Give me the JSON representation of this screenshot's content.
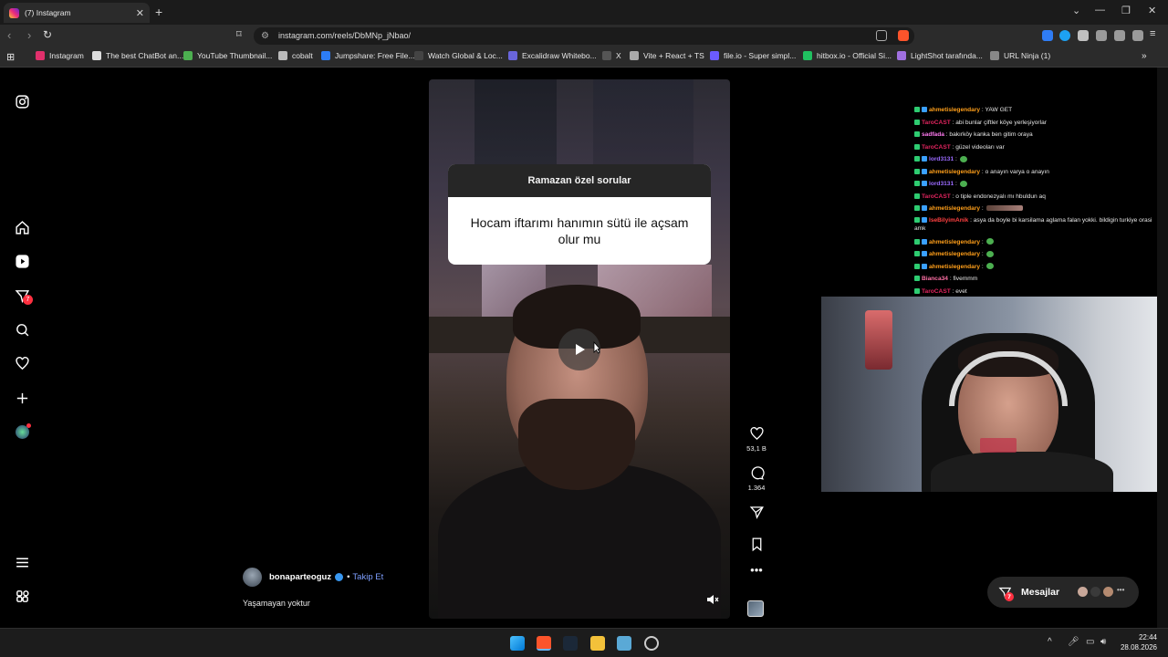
{
  "browser": {
    "tab_title": "(7) Instagram",
    "url": "instagram.com/reels/DbMNp_jNbao/",
    "bookmarks": [
      {
        "label": "Instagram",
        "color": "#e1306c"
      },
      {
        "label": "The best ChatBot an...",
        "color": "#dddddd"
      },
      {
        "label": "YouTube Thumbnail...",
        "color": "#4caf50"
      },
      {
        "label": "cobalt",
        "color": "#bbbbbb"
      },
      {
        "label": "Jumpshare: Free File...",
        "color": "#2d7df6"
      },
      {
        "label": "Watch Global & Loc...",
        "color": "#111111"
      },
      {
        "label": "Excalidraw Whitebo...",
        "color": "#6965db"
      },
      {
        "label": "X",
        "color": "#000000"
      },
      {
        "label": "Vite + React + TS",
        "color": "#aaaaaa"
      },
      {
        "label": "file.io - Super simpl...",
        "color": "#6b5bff"
      },
      {
        "label": "hitbox.io - Official Si...",
        "color": "#20c060"
      },
      {
        "label": "LightShot tarafında...",
        "color": "#a070e0"
      },
      {
        "label": "URL Ninja (1)",
        "color": "#888888"
      }
    ]
  },
  "sidebar": {
    "messages_badge": "7"
  },
  "reel": {
    "question_header": "Ramazan özel sorular",
    "question_text": "Hocam iftarımı hanımın sütü ile açsam olur mu",
    "likes": "53,1 B",
    "comments": "1.364",
    "author": "bonaparteoguz",
    "follow_label": "Takip Et",
    "caption": "Yaşamayan yoktur"
  },
  "chat": [
    {
      "user": "ahmetislegendary",
      "text": ": YAW GET",
      "color": "#ff9f1a"
    },
    {
      "user": "TaroCAST",
      "text": ": abi bunlar çiftler köye yerleşiyorlar",
      "color": "#e0245e"
    },
    {
      "user": "sadfada",
      "text": ": bakırköy kanka ben gitim oraya",
      "color": "#ff7af0"
    },
    {
      "user": "TaroCAST",
      "text": ": güzel videoları var",
      "color": "#e0245e"
    },
    {
      "user": "lord3131",
      "text": ":",
      "color": "#9b6bff",
      "emote": true
    },
    {
      "user": "ahmetislegendary",
      "text": ": o anayın varya o anayın",
      "color": "#ff9f1a"
    },
    {
      "user": "lord3131",
      "text": ":",
      "color": "#9b6bff",
      "emote": true
    },
    {
      "user": "TaroCAST",
      "text": ": o tiple endonezyalı mı hbuldun aq",
      "color": "#e0245e"
    },
    {
      "user": "ahmetislegendary",
      "text": ":",
      "color": "#ff9f1a",
      "wide": true
    },
    {
      "user": "IseBilyimAnik",
      "text": ": asya da boyle bi karsilama aglama falan yokki. bildigin turkiye orasi amk",
      "color": "#ff4040",
      "wrap": true
    },
    {
      "user": "ahmetislegendary",
      "text": ":",
      "color": "#ff9f1a",
      "emote": true
    },
    {
      "user": "ahmetislegendary",
      "text": ":",
      "color": "#ff9f1a",
      "emote": true
    },
    {
      "user": "ahmetislegendary",
      "text": ":",
      "color": "#ff9f1a",
      "emote": true
    },
    {
      "user": "Bianca34",
      "text": ": fivemmm",
      "color": "#ff70a6"
    },
    {
      "user": "TaroCAST",
      "text": ": evet",
      "color": "#e0245e"
    }
  ],
  "messages_pill": {
    "label": "Mesajlar",
    "badge": "7"
  },
  "taskbar": {
    "time": "22:44",
    "date": "28.08.2026"
  }
}
